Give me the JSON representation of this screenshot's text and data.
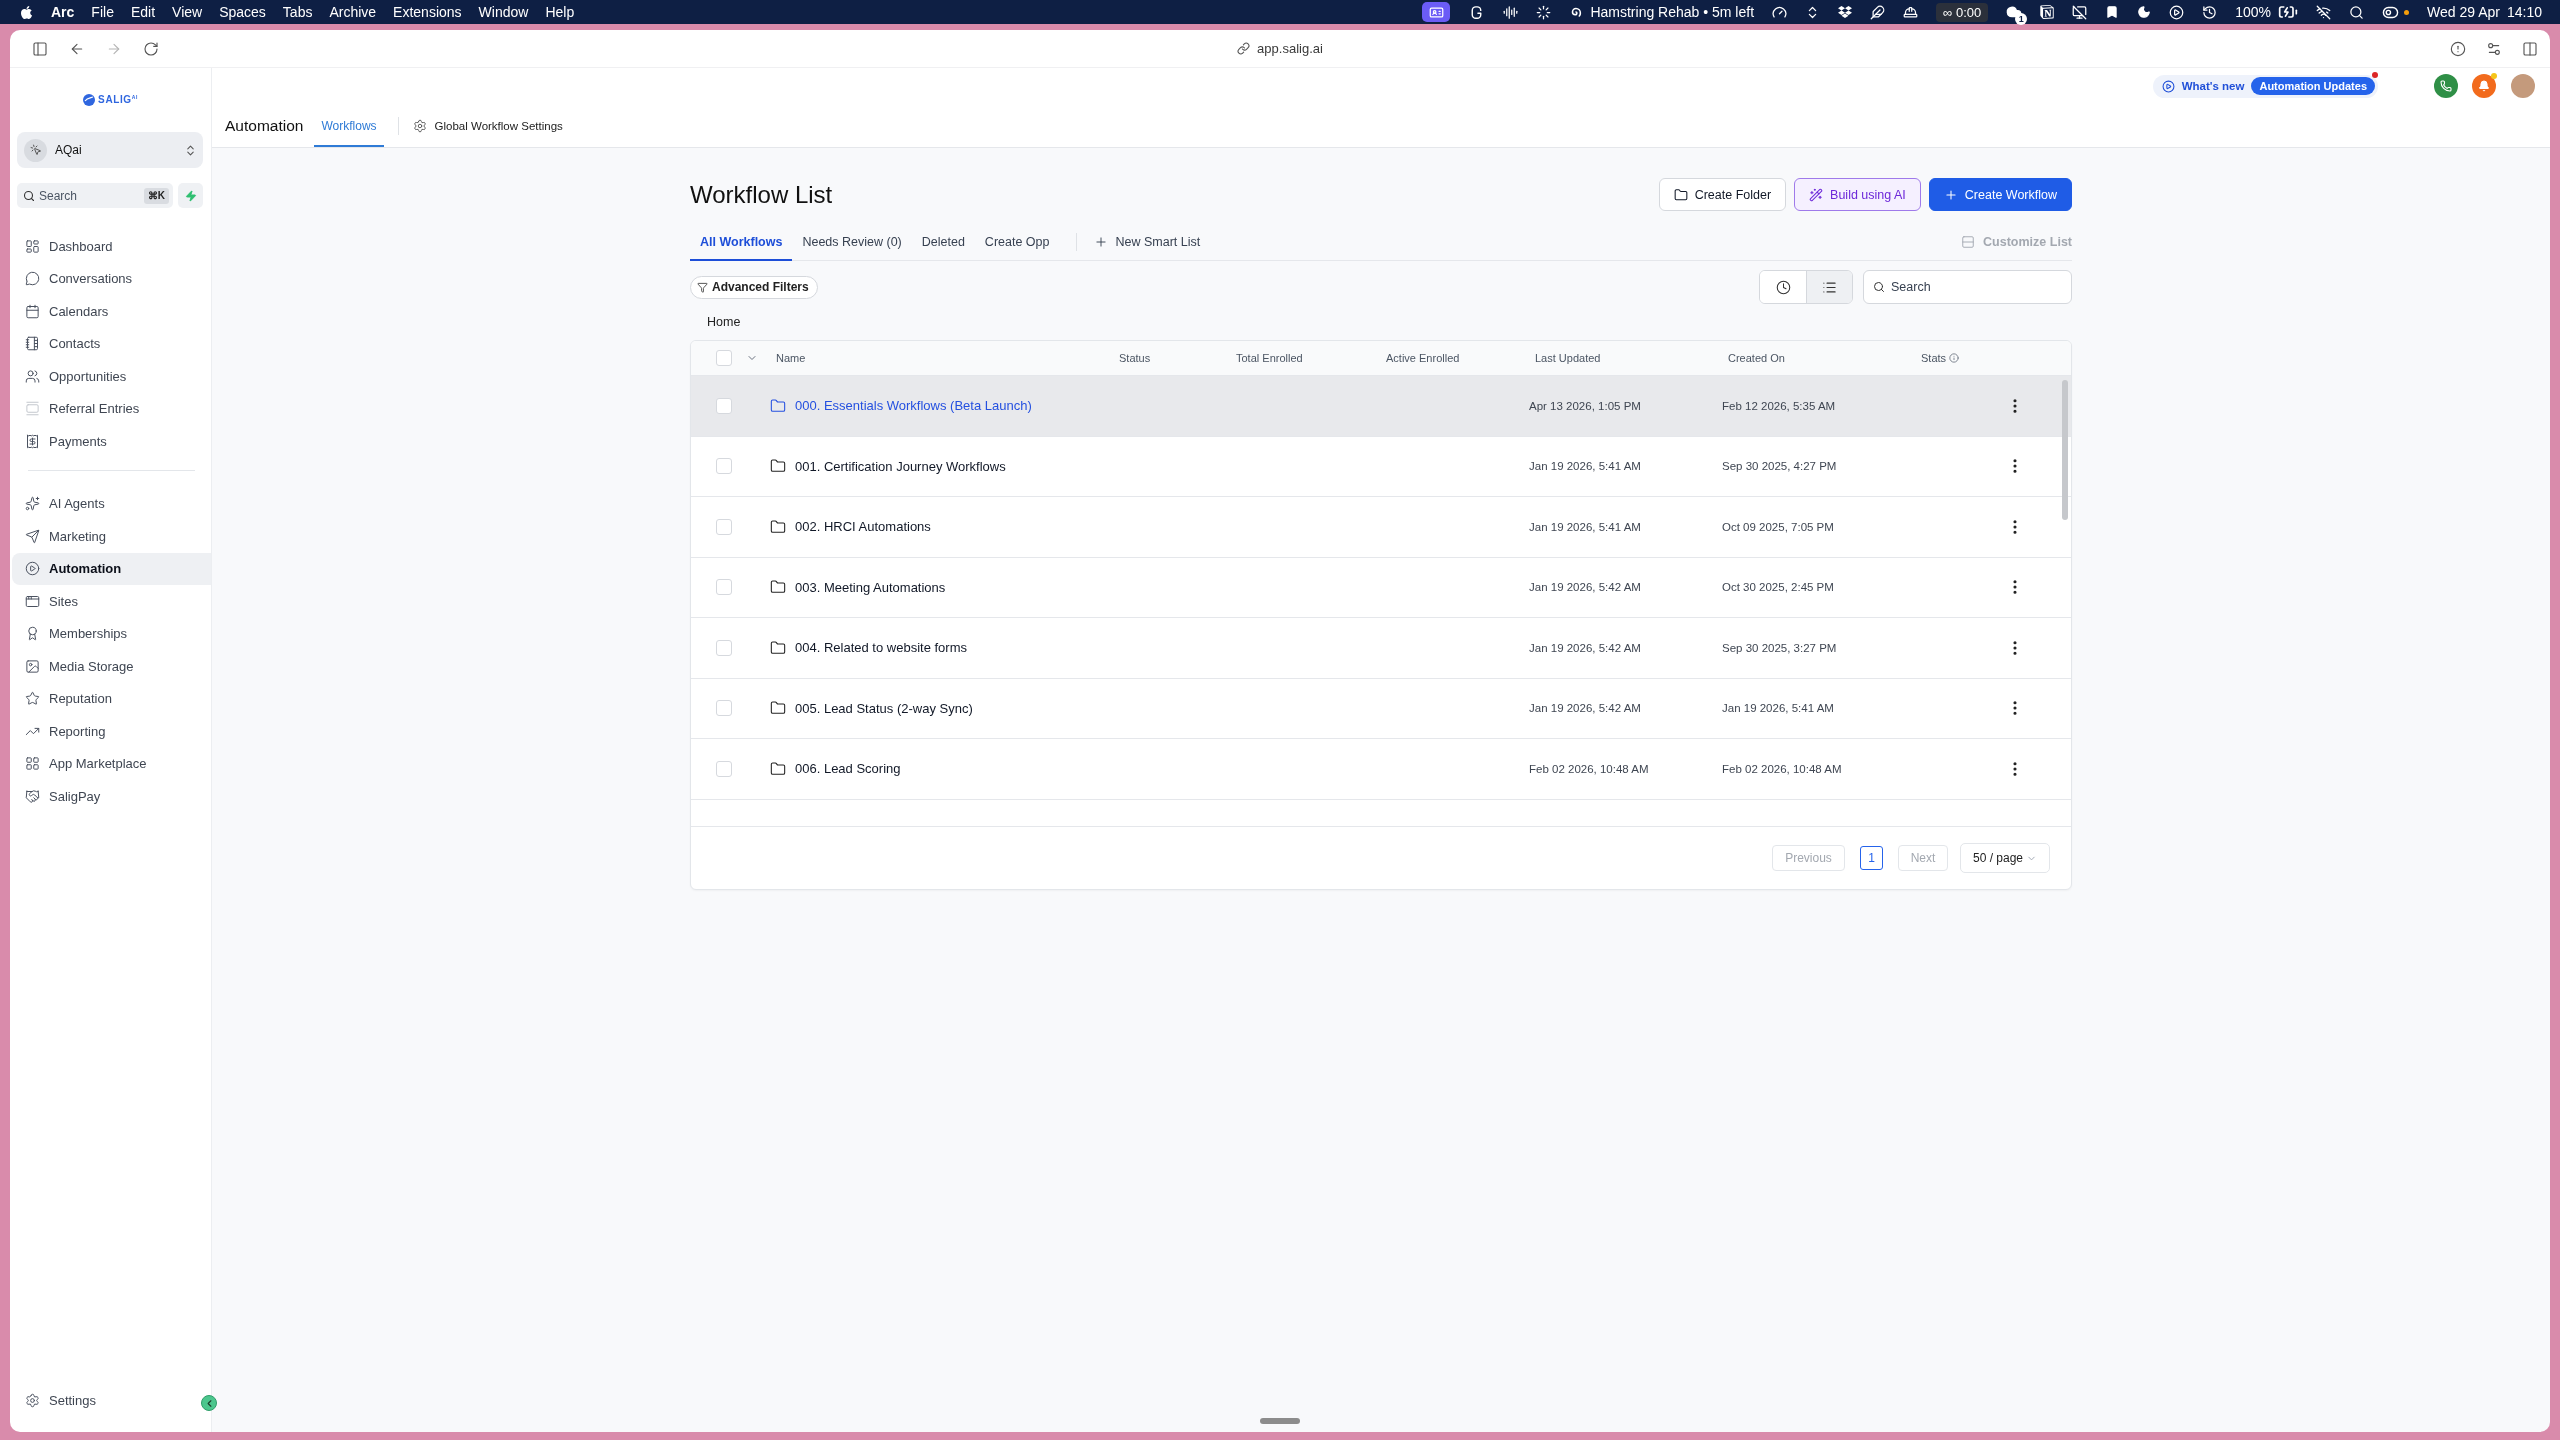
{
  "menu_bar": {
    "app": "Arc",
    "menus": [
      "File",
      "Edit",
      "View",
      "Spaces",
      "Tabs",
      "Archive",
      "Extensions",
      "Window",
      "Help"
    ],
    "focus_session": "Hamstring Rehab • 5m left",
    "timer": "∞ 0:00",
    "cloud_count": "1",
    "battery": "100%",
    "date": "Wed 29 Apr",
    "time": "14:10"
  },
  "browser": {
    "url": "app.salig.ai"
  },
  "sidebar": {
    "logo": "SALIG$^{AI}$",
    "account": "AQai",
    "search": {
      "placeholder": "Search",
      "shortcut": "⌘K"
    },
    "nav_groups": [
      {
        "items": [
          {
            "label": "Dashboard",
            "selected": false
          },
          {
            "label": "Conversations",
            "selected": false
          },
          {
            "label": "Calendars",
            "selected": false
          },
          {
            "label": "Contacts",
            "selected": false
          },
          {
            "label": "Opportunities",
            "selected": false
          },
          {
            "label": "Referral Entries",
            "selected": false
          },
          {
            "label": "Payments",
            "selected": false
          }
        ]
      },
      {
        "items": [
          {
            "label": "AI Agents",
            "selected": false
          },
          {
            "label": "Marketing",
            "selected": false
          },
          {
            "label": "Automation",
            "selected": true
          },
          {
            "label": "Sites",
            "selected": false
          },
          {
            "label": "Memberships",
            "selected": false
          },
          {
            "label": "Media Storage",
            "selected": false
          },
          {
            "label": "Reputation",
            "selected": false
          },
          {
            "label": "Reporting",
            "selected": false
          },
          {
            "label": "App Marketplace",
            "selected": false
          },
          {
            "label": "SaligPay",
            "selected": false
          }
        ]
      }
    ],
    "settings": "Settings"
  },
  "header": {
    "title": "Automation",
    "tabs": [
      {
        "label": "Workflows",
        "selected": true
      }
    ],
    "settings_link": "Global Workflow Settings",
    "whats_new": {
      "label": "What's new",
      "badge": "Automation Updates",
      "unread": true
    }
  },
  "page": {
    "title": "Workflow List",
    "actions": [
      {
        "label": "Create Folder",
        "kind": "outline"
      },
      {
        "label": "Build using AI",
        "kind": "ai"
      },
      {
        "label": "Create Workflow",
        "kind": "primary"
      }
    ],
    "tabs": [
      {
        "label": "All Workflows",
        "selected": true
      },
      {
        "label": "Needs Review (0)",
        "selected": false
      },
      {
        "label": "Deleted",
        "selected": false
      },
      {
        "label": "Create Opp",
        "selected": false
      }
    ],
    "new_smart_list": "New Smart List",
    "customize_list": {
      "label": "Customize List",
      "disabled": true
    },
    "advanced_filters": "Advanced Filters",
    "view_modes": [
      {
        "kind": "timeline",
        "selected": false
      },
      {
        "kind": "list",
        "selected": true
      }
    ],
    "search": {
      "placeholder": "Search"
    },
    "breadcrumb": "Home"
  },
  "table": {
    "select_all": {
      "checked": false
    },
    "columns": [
      "Name",
      "Status",
      "Total Enrolled",
      "Active Enrolled",
      "Last Updated",
      "Created On",
      "Stats"
    ],
    "rows": [
      {
        "name": "000. Essentials Workflows (Beta Launch)",
        "last_updated": "Apr 13 2026, 1:05 PM",
        "created_on": "Feb 12 2026, 5:35 AM",
        "highlighted": true,
        "checked": false
      },
      {
        "name": "001. Certification Journey Workflows",
        "last_updated": "Jan 19 2026, 5:41 AM",
        "created_on": "Sep 30 2025, 4:27 PM",
        "highlighted": false,
        "checked": false
      },
      {
        "name": "002. HRCI Automations",
        "last_updated": "Jan 19 2026, 5:41 AM",
        "created_on": "Oct 09 2025, 7:05 PM",
        "highlighted": false,
        "checked": false
      },
      {
        "name": "003. Meeting Automations",
        "last_updated": "Jan 19 2026, 5:42 AM",
        "created_on": "Oct 30 2025, 2:45 PM",
        "highlighted": false,
        "checked": false
      },
      {
        "name": "004. Related to website forms",
        "last_updated": "Jan 19 2026, 5:42 AM",
        "created_on": "Sep 30 2025, 3:27 PM",
        "highlighted": false,
        "checked": false
      },
      {
        "name": "005. Lead Status (2-way Sync)",
        "last_updated": "Jan 19 2026, 5:42 AM",
        "created_on": "Jan 19 2026, 5:41 AM",
        "highlighted": false,
        "checked": false
      },
      {
        "name": "006. Lead Scoring",
        "last_updated": "Feb 02 2026, 10:48 AM",
        "created_on": "Feb 02 2026, 10:48 AM",
        "highlighted": false,
        "checked": false
      }
    ]
  },
  "pagination": {
    "previous": {
      "label": "Previous",
      "disabled": true
    },
    "pages": [
      {
        "label": "1",
        "selected": true
      }
    ],
    "next": {
      "label": "Next",
      "disabled": true
    },
    "page_size": "50 / page"
  }
}
